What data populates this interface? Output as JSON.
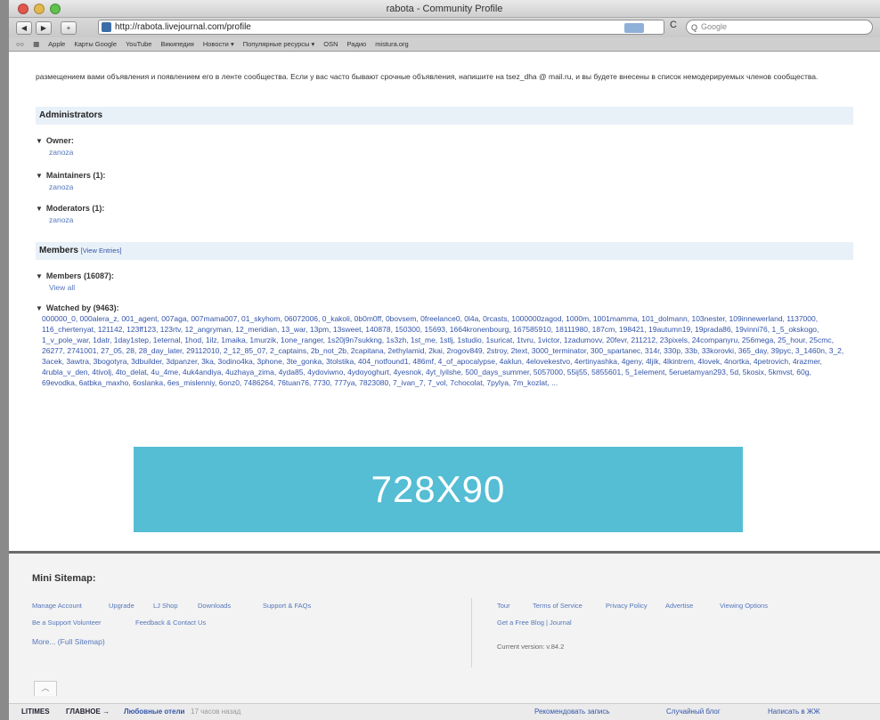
{
  "window": {
    "title": "rabota - Community Profile"
  },
  "toolbar": {
    "back": "◀",
    "forward": "▶",
    "add": "+",
    "url": "http://rabota.livejournal.com/profile",
    "reload": "C",
    "search_placeholder": "Google",
    "search_icon": "Q"
  },
  "bookmarks": [
    "Apple",
    "Карты Google",
    "YouTube",
    "Википедия",
    "Новости ▾",
    "Популярные ресурсы ▾",
    "OSN",
    "Радио",
    "mistura.org"
  ],
  "intro": "размещением вами объявления и появлением его в ленте сообщества. Если у вас часто бывают срочные объявления, напишите на tsez_dha @ mail.ru, и вы будете внесены в список немодерируемых членов сообщества.",
  "admin": {
    "title": "Administrators",
    "owner_label": "Owner:",
    "owner": "zanoza",
    "maintainers_label": "Maintainers (1):",
    "maintainer": "zanoza",
    "moderators_label": "Moderators (1):",
    "moderator": "zanoza"
  },
  "members": {
    "title": "Members",
    "view_entries": "[View Entries]",
    "count_label": "Members (16087):",
    "view_all": "View all",
    "watched_label": "Watched by (9463):",
    "watched_list": "000000_0, 000alera_z, 001_agent, 007aga, 007mama007, 01_skyhom, 06072006, 0_kakoli, 0b0m0ff, 0bovsem, 0freelance0, 0l4a, 0rcasts, 1000000zagod, 1000m, 1001mamma, 101_dolmann, 103nester, 109innewerland, 1137000, 116_chertenyat, 121142, 123ff123, 123rtv, 12_angryman, 12_meridian, 13_war, 13pm, 13sweet, 140878, 150300, 15693, 1664kronenbourg, 167585910, 18111980, 187cm, 198421, 19autumn19, 19prada86, 19vinni76, 1_5_okskogo, 1_v_pole_war, 1datr, 1day1step, 1eternal, 1hod, 1ilz, 1maika, 1murzik, 1one_ranger, 1s20j9n7sukkng, 1s3zh, 1st_me, 1stlj, 1studio, 1suricat, 1tvru, 1victor, 1zadumovv, 20fevr, 211212, 23pixels, 24companyru, 256mega, 25_hour, 25cmc, 26277, 2741001, 27_05, 28, 28_day_later, 29112010, 2_12_85_07, 2_captains, 2b_not_2b, 2capitana, 2ethylamid, 2kai, 2rogov849, 2stroy, 2text, 3000_terminator, 300_spartanec, 314r, 330p, 33b, 33korovki, 365_day, 39pyc, 3_1460n, 3_2, 3acek, 3awtra, 3bogotyra, 3dbuilder, 3dpanzer, 3ka, 3odino4ka, 3phone, 3te_gonka, 3tolstika, 404_notfound1, 486mf, 4_of_apocalypse, 4aklun, 4elovekestvo, 4ertinyashka, 4geny, 4ljik, 4lkintrem, 4lovek, 4nortka, 4petrovich, 4razmer, 4rubla_v_den, 4tivolj, 4to_delat, 4u_4me, 4uk4andiya, 4uzhaya_zima, 4yda85, 4ydoviwno, 4ydoyoghurt, 4yesnok, 4yt_lyilshe, 500_days_summer, 5057000, 55ij55, 5855601, 5_1element, 5eruetamyan293, 5d, 5kosix, 5kmvst, 60g, 69evodka, 6atbka_maxho, 6oslanka, 6es_mislenniy, 6onz0, 7486264, 76tuan76, 7730, 777ya, 7823080, 7_ivan_7, 7_vol, 7chocolat, 7pylya, 7m_kozlat, ..."
  },
  "ad": {
    "text": "728X90"
  },
  "footer": {
    "title": "Mini Sitemap:",
    "row1": [
      "Manage Account",
      "Upgrade",
      "LJ Shop",
      "Downloads",
      "Support & FAQs"
    ],
    "row2": [
      "Be a Support Volunteer",
      "Feedback & Contact Us"
    ],
    "more": "More... (Full Sitemap)",
    "right_row1": [
      "Tour",
      "Terms of Service",
      "Privacy Policy",
      "Advertise",
      "Viewing Options"
    ],
    "right_row2": "Get a Free Blog | Journal",
    "version": "Current version: v.84.2"
  },
  "bottom": {
    "brand": "LITIMES",
    "label": "ГЛАВНОЕ →",
    "story": "Любовные отели",
    "time": "17 часов назад",
    "recommend": "Рекомендовать запись",
    "random": "Случайный блог",
    "write": "Написать в ЖЖ",
    "up": "︿"
  }
}
